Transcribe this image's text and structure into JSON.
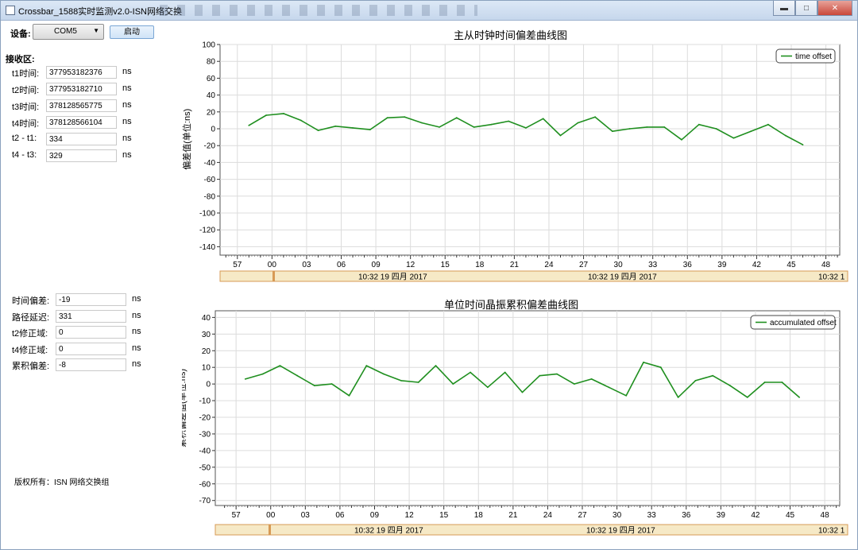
{
  "window": {
    "title": "Crossbar_1588实时监测v2.0-ISN网络交换",
    "controls": {
      "minimize": "▬",
      "maximize": "□",
      "close": "✕"
    }
  },
  "device": {
    "label": "设备:",
    "selected": "COM5",
    "start_button": "启动"
  },
  "receive": {
    "heading": "接收区:",
    "rows": [
      {
        "label": "t1时间:",
        "value": "377953182376",
        "unit": "ns"
      },
      {
        "label": "t2时间:",
        "value": "377953182710",
        "unit": "ns"
      },
      {
        "label": "t3时间:",
        "value": "378128565775",
        "unit": "ns"
      },
      {
        "label": "t4时间:",
        "value": "378128566104",
        "unit": "ns"
      },
      {
        "label": "t2 - t1:",
        "value": "334",
        "unit": "ns"
      },
      {
        "label": "t4 - t3:",
        "value": "329",
        "unit": "ns"
      }
    ]
  },
  "results": {
    "rows": [
      {
        "label": "时间偏差:",
        "value": "-19",
        "unit": "ns"
      },
      {
        "label": "路径延迟:",
        "value": "331",
        "unit": "ns"
      },
      {
        "label": "t2修正域:",
        "value": "0",
        "unit": "ns"
      },
      {
        "label": "t4修正域:",
        "value": "0",
        "unit": "ns"
      },
      {
        "label": "累积偏差:",
        "value": "-8",
        "unit": "ns"
      }
    ]
  },
  "copyright": "版权所有：ISN 网络交换组",
  "colors": {
    "series": "#1f8f1f",
    "scroll_bar": "#f6e9c6",
    "scroll_border": "#d79a55"
  },
  "chart_data": [
    {
      "type": "line",
      "title": "主从时钟时间偏差曲线图",
      "ylabel": "偏差值(单位:ns)",
      "xlabel": "",
      "ylim": [
        -150,
        100
      ],
      "yticks": [
        100,
        80,
        60,
        40,
        20,
        0,
        -20,
        -40,
        -60,
        -80,
        -100,
        -120,
        -140
      ],
      "xlim": [
        55.5,
        49.2
      ],
      "xticks": [
        "57",
        "00",
        "03",
        "06",
        "09",
        "12",
        "15",
        "18",
        "21",
        "24",
        "27",
        "30",
        "33",
        "36",
        "39",
        "42",
        "45",
        "48"
      ],
      "scroll_labels": [
        "10:32 19 四月 2017",
        "10:32 19 四月 2017",
        "10:32 1"
      ],
      "grid": true,
      "legend": "top-right",
      "series": [
        {
          "name": "time offset",
          "x": [
            58,
            59.5,
            61,
            62.5,
            64,
            65.5,
            67,
            68.5,
            70,
            71.5,
            73,
            74.5,
            76,
            77.5,
            79,
            80.5,
            82,
            83.5,
            85,
            86.5,
            88,
            89.5,
            91,
            92.5,
            94,
            95.5,
            97,
            98.5,
            100,
            101.5,
            103,
            104.5,
            106
          ],
          "values": [
            4,
            16,
            18,
            10,
            -2,
            3,
            1,
            -1,
            13,
            14,
            7,
            2,
            13,
            2,
            5,
            9,
            1,
            12,
            -8,
            7,
            14,
            -3,
            0,
            2,
            2,
            -13,
            5,
            0,
            -11,
            -3,
            5,
            -8,
            -19
          ]
        }
      ]
    },
    {
      "type": "line",
      "title": "单位时间晶振累积偏差曲线图",
      "ylabel": "累积偏差值(单位:ns)",
      "xlabel": "",
      "ylim": [
        -73,
        44
      ],
      "yticks": [
        40,
        30,
        20,
        10,
        0,
        -10,
        -20,
        -30,
        -40,
        -50,
        -60,
        -70
      ],
      "xlim": [
        55.2,
        49.3
      ],
      "xticks": [
        "57",
        "00",
        "03",
        "06",
        "09",
        "12",
        "15",
        "18",
        "21",
        "24",
        "27",
        "30",
        "33",
        "36",
        "39",
        "42",
        "45",
        "48"
      ],
      "scroll_labels": [
        "10:32 19 四月 2017",
        "10:32 19 四月 2017",
        "10:32 1"
      ],
      "grid": true,
      "legend": "top-right",
      "series": [
        {
          "name": "accumulated offset",
          "x": [
            57.8,
            59.3,
            60.8,
            62.3,
            63.8,
            65.3,
            66.8,
            68.3,
            69.8,
            71.3,
            72.8,
            74.3,
            75.8,
            77.3,
            78.8,
            80.3,
            81.8,
            83.3,
            84.8,
            86.3,
            87.8,
            89.3,
            90.8,
            92.3,
            93.8,
            95.3,
            96.8,
            98.3,
            99.8,
            101.3,
            102.8,
            104.3,
            105.8
          ],
          "values": [
            3,
            6,
            11,
            5,
            -1,
            0,
            -7,
            11,
            6,
            2,
            1,
            11,
            0,
            7,
            -2,
            7,
            -5,
            5,
            6,
            0,
            3,
            -2,
            -7,
            13,
            10,
            -8,
            2,
            5,
            -1,
            -8,
            1,
            1,
            -8
          ]
        }
      ]
    }
  ]
}
